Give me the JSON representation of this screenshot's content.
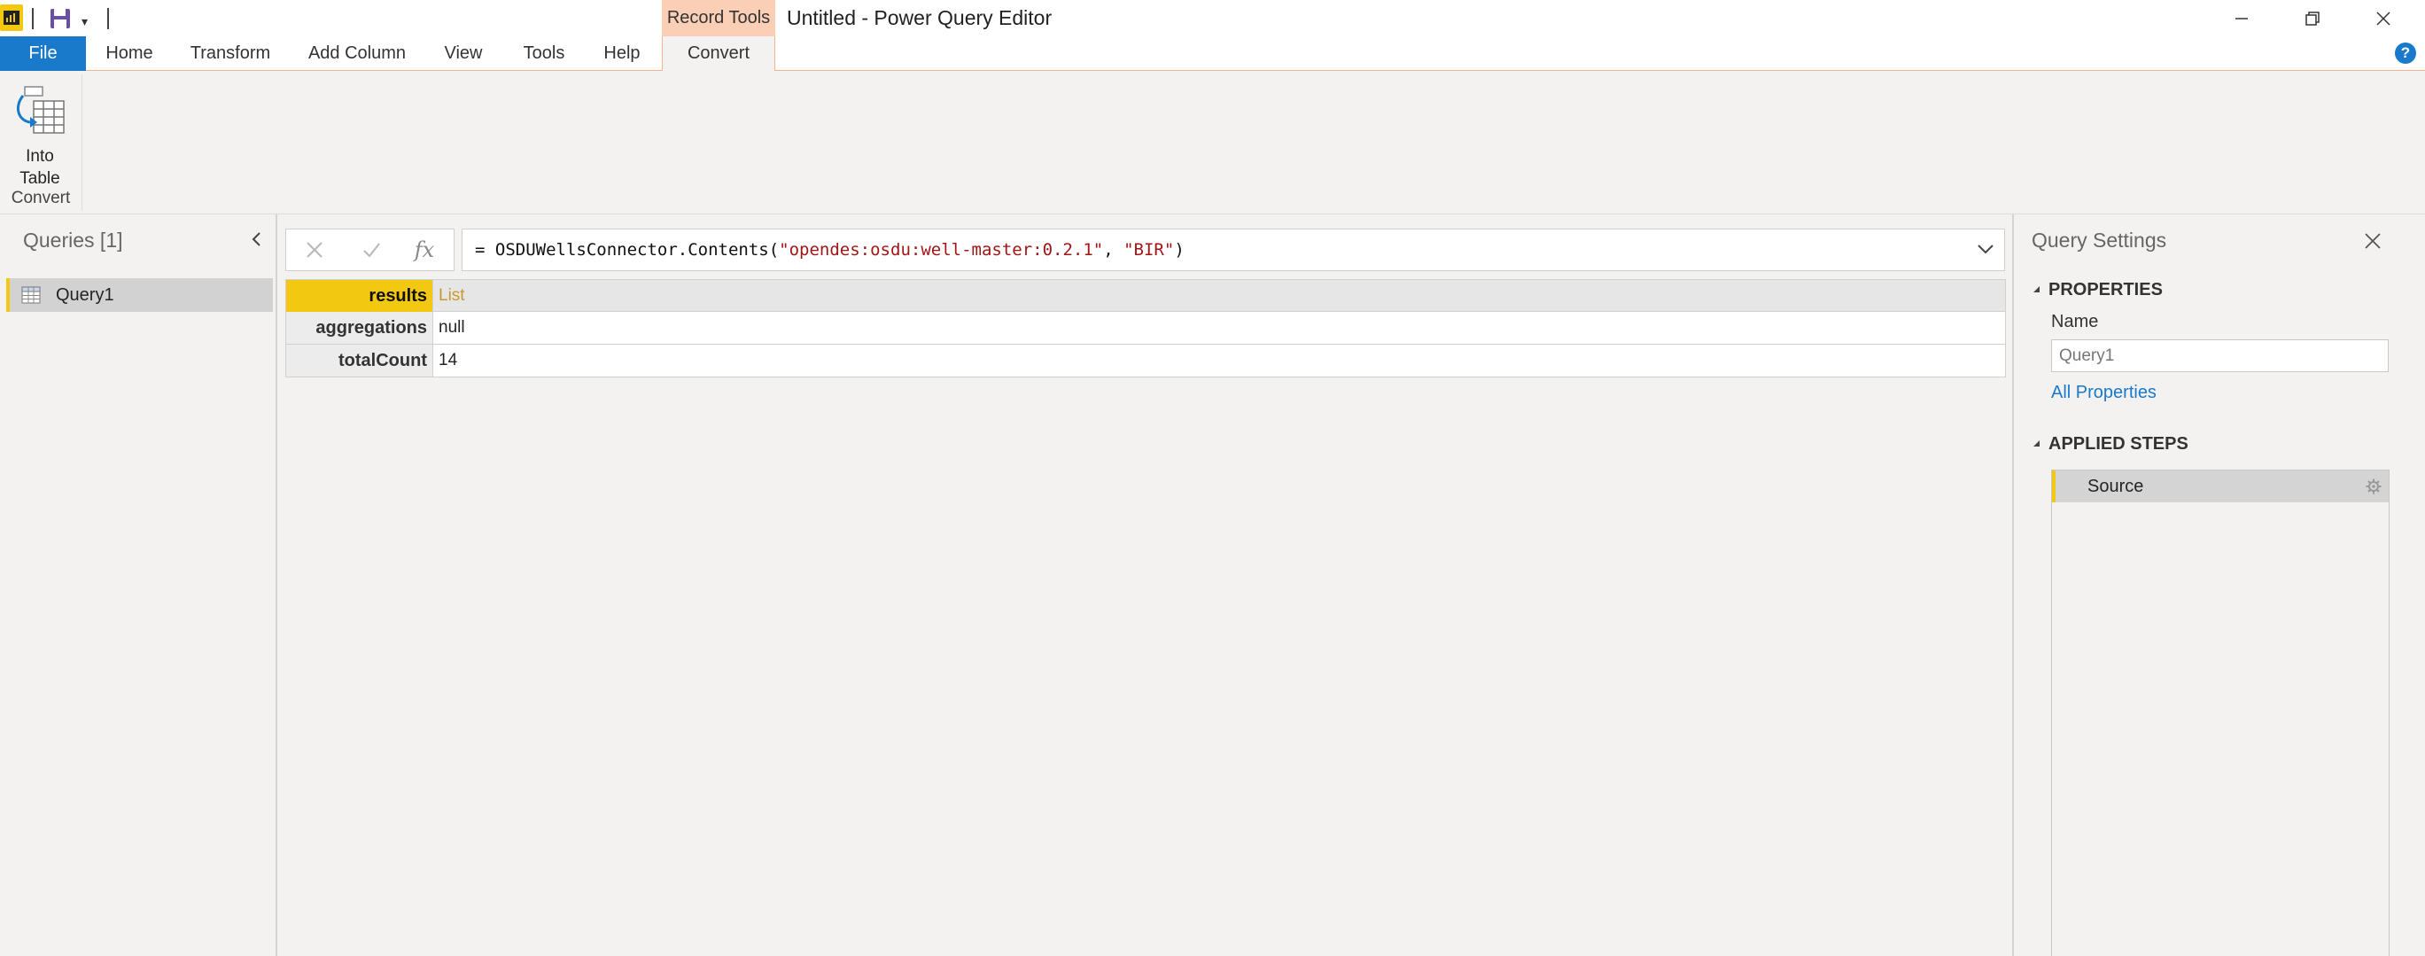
{
  "titlebar": {
    "context_tab_header": "Record Tools",
    "window_title": "Untitled - Power Query Editor"
  },
  "tabs": [
    {
      "label": "File"
    },
    {
      "label": "Home"
    },
    {
      "label": "Transform"
    },
    {
      "label": "Add Column"
    },
    {
      "label": "View"
    },
    {
      "label": "Tools"
    },
    {
      "label": "Help"
    },
    {
      "label": "Convert"
    }
  ],
  "ribbon": {
    "into_table_label": "Into\nTable",
    "group_label": "Convert"
  },
  "queries": {
    "title": "Queries [1]",
    "items": [
      {
        "label": "Query1"
      }
    ]
  },
  "formula": {
    "prefix": "= OSDUWellsConnector.Contents(",
    "arg1": "\"opendes:osdu:well-master:0.2.1\"",
    "sep": ", ",
    "arg2": "\"BIR\"",
    "suffix": ")"
  },
  "record": {
    "rows": [
      {
        "key": "results",
        "value": "List"
      },
      {
        "key": "aggregations",
        "value": "null"
      },
      {
        "key": "totalCount",
        "value": "14"
      }
    ]
  },
  "settings": {
    "title": "Query Settings",
    "properties_label": "PROPERTIES",
    "name_label": "Name",
    "name_value": "Query1",
    "all_properties_link": "All Properties",
    "applied_steps_label": "APPLIED STEPS",
    "steps": [
      {
        "label": "Source"
      }
    ]
  },
  "colors": {
    "accent_yellow": "#f2c811",
    "file_tab_blue": "#1979ca",
    "context_tab_orange": "#fbcfb5",
    "string_red": "#a31515",
    "list_link": "#c89a2d"
  }
}
